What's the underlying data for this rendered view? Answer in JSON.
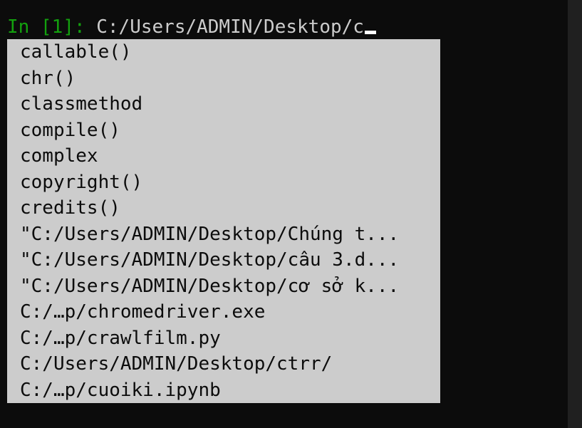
{
  "terminal": {
    "prompt": {
      "in": "In ",
      "number": "[1]",
      "colon": ": "
    },
    "input_text": "C:/Users/ADMIN/Desktop/c"
  },
  "completions": [
    "callable()",
    "chr()",
    "classmethod",
    "compile()",
    "complex",
    "copyright()",
    "credits()",
    "\"C:/Users/ADMIN/Desktop/Chúng t...",
    "\"C:/Users/ADMIN/Desktop/câu 3.d...",
    "\"C:/Users/ADMIN/Desktop/cơ sở k...",
    "C:/…p/chromedriver.exe",
    "C:/…p/crawlfilm.py",
    "C:/Users/ADMIN/Desktop/ctrr/",
    "C:/…p/cuoiki.ipynb"
  ],
  "colors": {
    "background": "#0c0c0c",
    "prompt_green": "#13a10e",
    "text": "#cccccc",
    "menu_background": "#cccccc",
    "menu_text": "#0c0c0c",
    "scroll_strip": "#202020"
  }
}
